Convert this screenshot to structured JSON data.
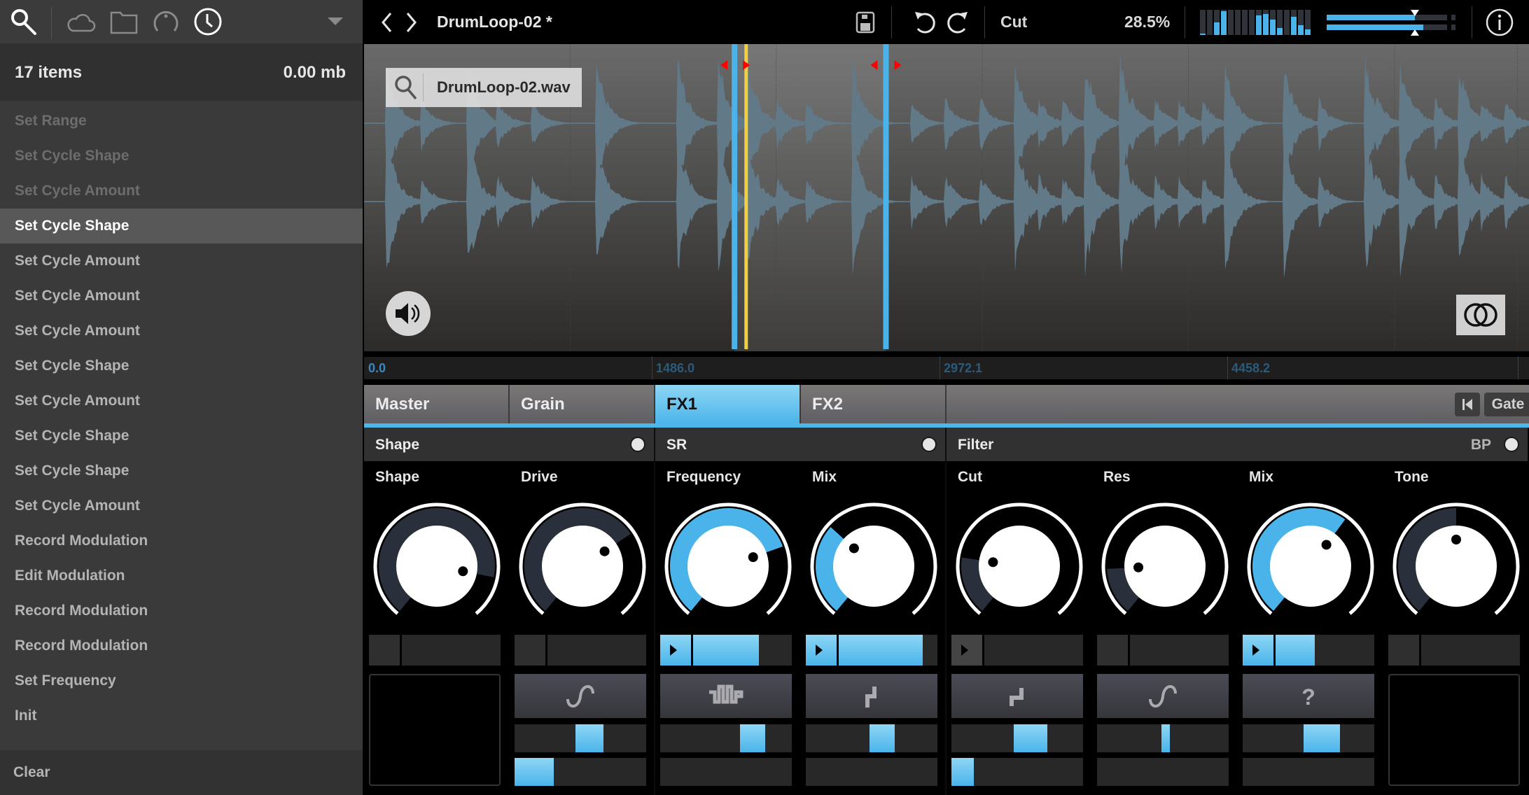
{
  "sidebar": {
    "icons": [
      "search-icon",
      "cloud-icon",
      "folder-icon",
      "knob-icon",
      "clock-icon",
      "dropdown-arrow-icon"
    ],
    "count_label": "17 items",
    "size_label": "0.00 mb",
    "items": [
      {
        "label": "Set Range",
        "state": "dim"
      },
      {
        "label": "Set Cycle Shape",
        "state": "dim"
      },
      {
        "label": "Set Cycle Amount",
        "state": "dim"
      },
      {
        "label": "Set Cycle Shape",
        "state": "selected"
      },
      {
        "label": "Set Cycle Amount",
        "state": "normal"
      },
      {
        "label": "Set Cycle Amount",
        "state": "normal"
      },
      {
        "label": "Set Cycle Amount",
        "state": "normal"
      },
      {
        "label": "Set Cycle Shape",
        "state": "normal"
      },
      {
        "label": "Set Cycle Amount",
        "state": "normal"
      },
      {
        "label": "Set Cycle Shape",
        "state": "normal"
      },
      {
        "label": "Set Cycle Shape",
        "state": "normal"
      },
      {
        "label": "Set Cycle Amount",
        "state": "normal"
      },
      {
        "label": "Record Modulation",
        "state": "normal"
      },
      {
        "label": "Edit Modulation",
        "state": "normal"
      },
      {
        "label": "Record Modulation",
        "state": "normal"
      },
      {
        "label": "Record Modulation",
        "state": "normal"
      },
      {
        "label": "Set Frequency",
        "state": "normal"
      },
      {
        "label": "Init",
        "state": "normal"
      }
    ],
    "clear_label": "Clear"
  },
  "topbar": {
    "title": "DrumLoop-02 *",
    "param_name": "Cut",
    "param_value": "28.5%",
    "meter_levels": [
      0.05,
      0,
      0.5,
      0.95,
      0,
      0,
      0,
      0,
      0.78,
      0.83,
      0.6,
      0.28,
      0,
      0.72,
      0.38,
      0.22
    ],
    "output_levels": [
      0.73,
      0.8
    ],
    "output_marker": 0.73
  },
  "waveform": {
    "file_name": "DrumLoop-02.wav",
    "selection_start": 0.318,
    "selection_end": 0.448,
    "playhead": 0.328,
    "ruler_labels": [
      "0.0",
      "1486.0",
      "2972.1",
      "4458.2"
    ]
  },
  "tabs": {
    "items": [
      "Master",
      "Grain",
      "FX1",
      "FX2"
    ],
    "active": 2,
    "gate_label": "Gate"
  },
  "sections": [
    {
      "title": "Shape",
      "mode": ""
    },
    {
      "title": "SR",
      "mode": ""
    },
    {
      "title": "Filter",
      "mode": "BP"
    }
  ],
  "controls": [
    {
      "label": "Shape",
      "value": 0.86,
      "color": "dark",
      "mod_play": "none",
      "mod_amount": 0,
      "shape_icon": "",
      "slider": null,
      "bar": null,
      "empty": true
    },
    {
      "label": "Drive",
      "value": 0.7,
      "color": "dark",
      "mod_play": "none",
      "mod_amount": 0,
      "shape_icon": "sine",
      "slider": 0.57,
      "bar": 0.3,
      "empty": false
    },
    {
      "label": "Frequency",
      "value": 0.75,
      "color": "blue",
      "mod_play": "on",
      "mod_amount": 0.67,
      "shape_icon": "steps",
      "slider": 0.7,
      "bar": 0,
      "empty": false
    },
    {
      "label": "Mix",
      "value": 0.33,
      "color": "blue",
      "mod_play": "on",
      "mod_amount": 0.85,
      "shape_icon": "step",
      "slider": 0.58,
      "bar": 0,
      "empty": false
    },
    {
      "label": "Cut",
      "value": 0.21,
      "color": "dark",
      "mod_play": "dim",
      "mod_amount": 0,
      "shape_icon": "step-up",
      "slider": 0.6,
      "bar": 0.17,
      "empty": false
    },
    {
      "label": "Res",
      "value": 0.17,
      "color": "dark",
      "mod_play": "none",
      "mod_amount": 0,
      "shape_icon": "sine",
      "slider": 0.52,
      "bar": 0,
      "empty": false
    },
    {
      "label": "Mix",
      "value": 0.63,
      "color": "blue",
      "mod_play": "on",
      "mod_amount": 0.4,
      "shape_icon": "random",
      "slider": 0.6,
      "bar": 0,
      "empty": false
    },
    {
      "label": "Tone",
      "value": 0.5,
      "color": "dark",
      "mod_play": "none",
      "mod_amount": 0,
      "shape_icon": "",
      "slider": null,
      "bar": null,
      "empty": true
    }
  ],
  "colors": {
    "accent": "#4ab4ea",
    "playhead": "#f0d040",
    "loop_marker": "#ff0000",
    "knob_dark": "#2a2f3c"
  }
}
